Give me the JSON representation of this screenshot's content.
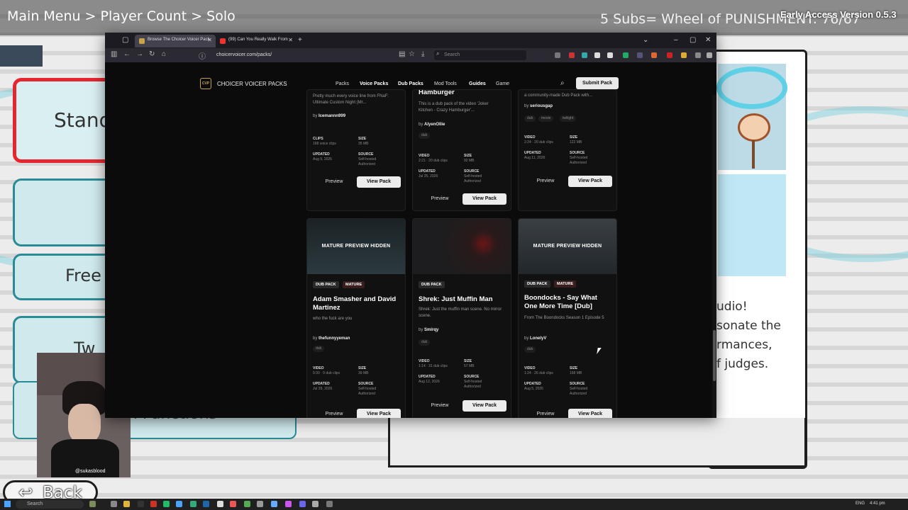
{
  "game": {
    "breadcrumb": "Main Menu > Player Count > Solo",
    "wheel_text": "5 Subs= Wheel of PUNISHMENT: 76/67",
    "version_text": "Early Access Version 0.5.3",
    "menu": [
      {
        "label": "Stand"
      },
      {
        "label": ""
      },
      {
        "label": "Free"
      },
      {
        "label": "Tw"
      }
    ],
    "panel_text": "n Functions",
    "right_panel_lines": [
      "udio!",
      "sonate the",
      "rmances,",
      "f judges."
    ],
    "back_label": "Back",
    "webcam_handle": "@sukasblood",
    "colors": {
      "accent_red": "#e52630",
      "teal_border": "#2a8a96",
      "button_fill": "#cfe9ec"
    }
  },
  "browser": {
    "tabs": [
      {
        "title": "Browse The Choicer Voicer Pack",
        "active": true
      },
      {
        "title": "(99) Can You Really Walk From",
        "active": false
      }
    ],
    "url": "choicervoicer.com/packs/",
    "search_placeholder": "Search"
  },
  "site": {
    "logo_mark": "CVP",
    "logo_text": "CHOICER VOICER PACKS",
    "nav": [
      {
        "label": "Packs",
        "bold": false
      },
      {
        "label": "Voice Packs",
        "bold": true
      },
      {
        "label": "Dub Packs",
        "bold": true
      },
      {
        "label": "Mod Tools",
        "bold": false
      },
      {
        "label": "Guides",
        "bold": true
      },
      {
        "label": "Game",
        "bold": false
      }
    ],
    "submit_label": "Submit Pack",
    "preview_label": "Preview",
    "view_label": "View Pack",
    "by_prefix": "by",
    "source_key": "SOURCE",
    "updated_key": "UPDATED",
    "size_key": "SIZE",
    "source_val_1": "Self-hosted",
    "source_val_2": "Authorized"
  },
  "cards_top": [
    {
      "desc": "Pretty much every voice line from FNaF: Ultimate Custom Night (Mr...",
      "author": "Icemannn999",
      "tags": [],
      "stat_key": "CLIPS",
      "stat_val": "168 voice clips",
      "size": "35 MB",
      "updated": "Aug 9, 2026"
    },
    {
      "title_partial": "Hamburger",
      "desc": "This is a dub pack of the video 'Joker Kitchen - Crazy Hamburger'...",
      "author": "AlyenOllie",
      "tags": [
        "dub"
      ],
      "stat_key": "VIDEO",
      "stat_val": "2:21 · 20 dub clips",
      "size": "92 MB",
      "updated": "Jul 25, 2026"
    },
    {
      "desc": "a community-made Dub Pack with...",
      "author": "seriousgap",
      "tags": [
        "dub",
        "movie",
        "twilight"
      ],
      "stat_key": "VIDEO",
      "stat_val": "2:24 · 20 dub clips",
      "size": "122 MB",
      "updated": "Aug 11, 2026"
    }
  ],
  "cards_bottom": [
    {
      "thumb_label": "MATURE PREVIEW HIDDEN",
      "badges": [
        "DUB PACK",
        "MATURE"
      ],
      "title": "Adam Smasher and David Martinez",
      "desc": "who the fuck are you",
      "author": "thefunnyyeman",
      "tags": [
        "dub"
      ],
      "video": "0:30 · 9 dub clips",
      "size": "39 MB",
      "updated": "Jul 29, 2026"
    },
    {
      "thumb_label": "",
      "badges": [
        "DUB PACK"
      ],
      "title": "Shrek: Just Muffin Man",
      "desc": "Shrek: Just the muffin man scene. No mirror scene.",
      "author": "Smirqy",
      "tags": [
        "dub"
      ],
      "video": "1:14 · 31 dub clips",
      "size": "57 MB",
      "updated": "Aug 12, 2026"
    },
    {
      "thumb_label": "MATURE PREVIEW HIDDEN",
      "badges": [
        "DUB PACK",
        "MATURE"
      ],
      "title": "Boondocks - Say What One More Time [Dub]",
      "desc": "From The Boondocks Season 1 Episode 5",
      "author": "LonelyV",
      "tags": [
        "dub"
      ],
      "video": "1:24 · 26 dub clips",
      "size": "168 MB",
      "updated": "Aug 5, 2026"
    }
  ],
  "taskbar": {
    "search_text": "Search",
    "lang": "ENG",
    "time": "4:41 pm"
  }
}
